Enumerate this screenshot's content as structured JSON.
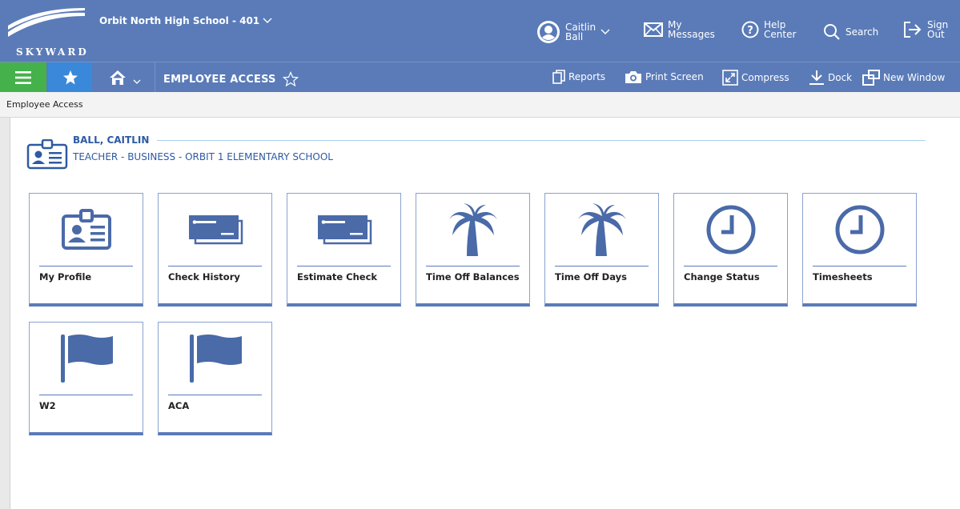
{
  "header": {
    "logo_text": "SKYWARD",
    "school": "Orbit North High School - 401",
    "user_first": "Caitlin",
    "user_last": "Ball",
    "messages_1": "My",
    "messages_2": "Messages",
    "help_1": "Help",
    "help_2": "Center",
    "search": "Search",
    "signout_1": "Sign",
    "signout_2": "Out"
  },
  "navbar": {
    "title": "EMPLOYEE ACCESS",
    "tools": {
      "reports": "Reports",
      "print": "Print Screen",
      "compress": "Compress",
      "dock": "Dock",
      "new_window": "New Window"
    }
  },
  "breadcrumb": "Employee Access",
  "employee": {
    "name": "BALL, CAITLIN",
    "role": "TEACHER - BUSINESS - ORBIT 1 ELEMENTARY SCHOOL"
  },
  "tiles": [
    {
      "label": "My Profile",
      "icon": "id-card-icon"
    },
    {
      "label": "Check History",
      "icon": "check-icon"
    },
    {
      "label": "Estimate Check",
      "icon": "check-icon"
    },
    {
      "label": "Time Off Balances",
      "icon": "palm-tree-icon"
    },
    {
      "label": "Time Off Days",
      "icon": "palm-tree-icon"
    },
    {
      "label": "Change Status",
      "icon": "clock-icon"
    },
    {
      "label": "Timesheets",
      "icon": "clock-icon"
    },
    {
      "label": "W2",
      "icon": "flag-icon"
    },
    {
      "label": "ACA",
      "icon": "flag-icon"
    }
  ],
  "colors": {
    "header_blue": "#5a7bb8",
    "hamburger_green": "#45b14b",
    "star_blue": "#3a88d9",
    "icon_blue": "#4a6aa8"
  }
}
